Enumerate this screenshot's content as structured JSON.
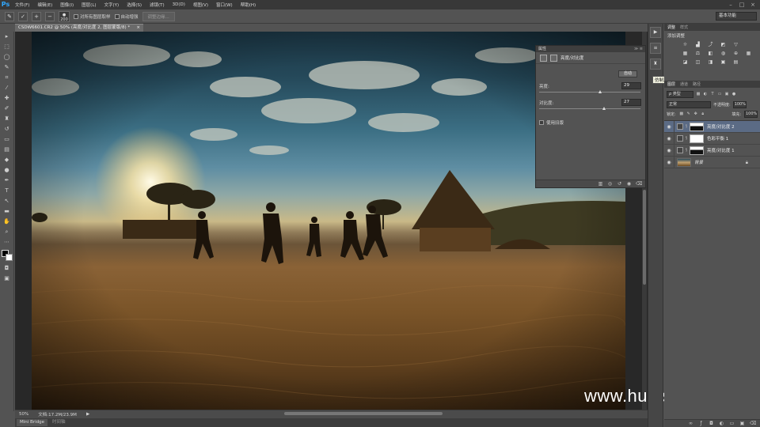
{
  "menubar": {
    "logo": "Ps",
    "items": [
      "文件(F)",
      "编辑(E)",
      "图像(I)",
      "图层(L)",
      "文字(Y)",
      "选择(S)",
      "滤镜(T)",
      "3D(D)",
      "视图(V)",
      "窗口(W)",
      "帮助(H)"
    ],
    "win_min": "–",
    "win_max": "□",
    "win_close": "×"
  },
  "options": {
    "tool_icon": "brush-tool-icon",
    "brush_size": "200",
    "sample_all_layers": "对所有图层取样",
    "auto_enhance": "自动增强",
    "refine_edge": "调整边缘...",
    "workspace": "基本功能"
  },
  "document": {
    "tab_title": "CSDW6601.CR2 @ 50% (亮度/对比度 2, 图层蒙版/8) *",
    "tab_close": "×"
  },
  "status": {
    "zoom": "50%",
    "doc_size": "文档:17.2M/23.9M",
    "arrow": "▶"
  },
  "bottom_tabs": [
    "Mini Bridge",
    "时间轴"
  ],
  "watermark": "www.hunls.com",
  "properties": {
    "tab": "属性",
    "controls": "≫ ≡",
    "title": "亮度/对比度",
    "auto_button": "自动",
    "brightness_label": "亮度:",
    "brightness_value": "29",
    "contrast_label": "对比度:",
    "contrast_value": "27",
    "legacy_label": "使用旧版"
  },
  "tooltip": "仿制源",
  "adjustments_panel": {
    "tabs": [
      "调整",
      "样式"
    ],
    "title": "添加调整",
    "icons": [
      "brightness-icon",
      "levels-icon",
      "curves-icon",
      "exposure-icon",
      "vibrance-icon",
      "hue-sat-icon",
      "color-balance-icon",
      "bw-icon",
      "photo-filter-icon",
      "channel-mixer-icon",
      "color-lookup-icon",
      "invert-icon",
      "posterize-icon",
      "threshold-icon",
      "selective-color-icon",
      "gradient-map-icon"
    ]
  },
  "layers_panel": {
    "tabs": [
      "图层",
      "通道",
      "路径"
    ],
    "kind_filter": "ρ 类型",
    "blend_mode": "正常",
    "opacity_label": "不透明度:",
    "opacity_value": "100%",
    "lock_label": "锁定:",
    "fill_label": "填充:",
    "fill_value": "100%",
    "layers": [
      {
        "name": "亮度/对比度 2",
        "selected": true
      },
      {
        "name": "色彩平衡 1",
        "selected": false
      },
      {
        "name": "亮度/对比度 1",
        "selected": false
      },
      {
        "name": "背景",
        "selected": false
      }
    ]
  },
  "colors": {
    "menubar_bg": "#383838",
    "panel_bg": "#535353",
    "selected_layer": "#5b6b85",
    "accent_logo": "#31a8ff"
  }
}
